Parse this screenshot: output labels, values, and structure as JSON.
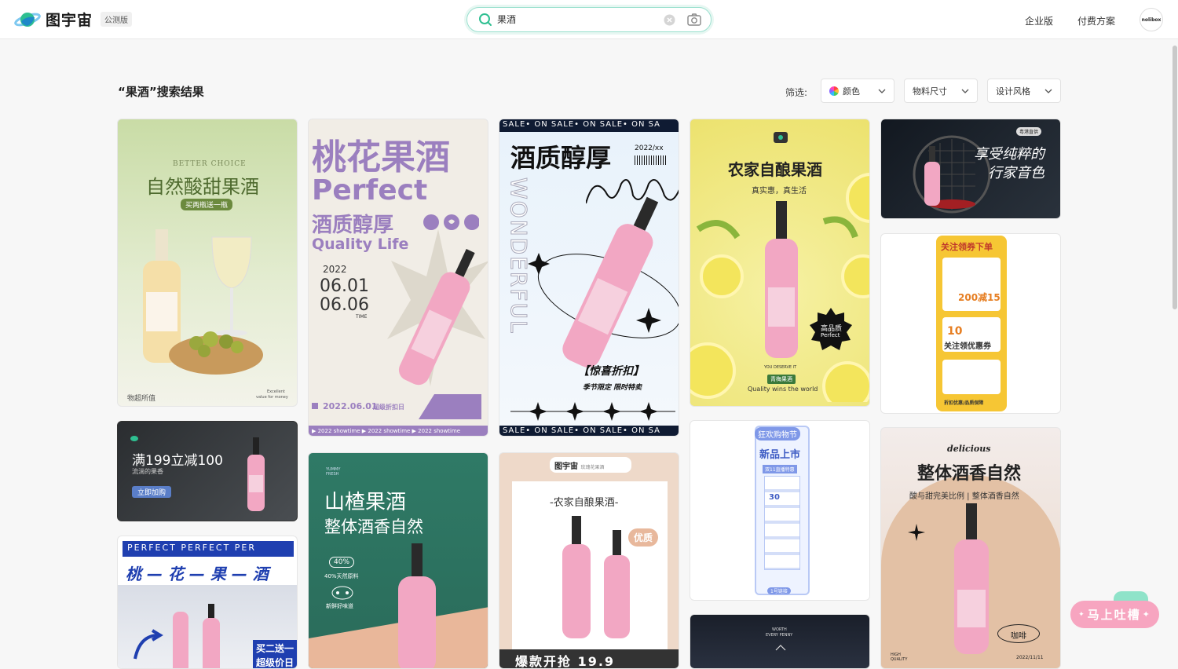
{
  "app": {
    "name": "图宇宙",
    "badge": "公测版"
  },
  "search": {
    "value": "果酒"
  },
  "nav": {
    "enterprise": "企业版",
    "pricing": "付费方案",
    "avatar": "nolibox"
  },
  "results": {
    "title": "“果酒”搜索结果",
    "filter_label": "筛选:"
  },
  "filters": [
    {
      "label": "颜色",
      "icon": "color-wheel-icon"
    },
    {
      "label": "物料尺寸"
    },
    {
      "label": "设计风格"
    }
  ],
  "feedback_button": "马上吐槽",
  "colors": {
    "accent": "#2ebf91",
    "bottle_pink": "#f2a7c3",
    "feedback": "#f7a5c0"
  },
  "cards": {
    "c1": {
      "top": "BETTER CHOICE",
      "title": "自然酸甜果酒",
      "tag": "买两瓶送一瓶",
      "foot_left": "物超所值",
      "foot_right1": "Excellent",
      "foot_right2": "value for money"
    },
    "c2": {
      "title": "桃花果酒",
      "perfect": "Perfect",
      "sub": "酒质醇厚",
      "quality": "Quality Life",
      "year": "2022",
      "d1": "06.01",
      "d2": "06.06",
      "time": "TIME",
      "date_line": "2022.06.01",
      "date_tag": "超级折扣日",
      "showtime": "▶ 2022 showtime  ▶ 2022 showtime  ▶ 2022 showtime"
    },
    "c3": {
      "sale": "SALE• ON  SALE• ON  SALE• ON  SA",
      "title": "酒质醇厚",
      "year": "2022/xx",
      "vertical": "WONDERFUL",
      "promo": "【惊喜折扣】",
      "promo_sub": "季节限定  限时特卖"
    },
    "c4": {
      "title": "农家自酿果酒",
      "sub": "真实惠，真生活",
      "badge1": "高品质",
      "badge2": "Perfect",
      "deserve": "YOU DESERVE IT",
      "tag": "青梅果酒",
      "world": "Quality wins the world"
    },
    "c5": {
      "badge": "粤港直供",
      "title1": "享受纯粹的",
      "title2": "行家音色"
    },
    "c6": {
      "title": "关注领券下单",
      "amount": "200减15",
      "ten": "10",
      "coupon": "关注领优惠券",
      "foot": "折扣优惠/品质保障"
    },
    "c7": {
      "title": "满199立减100",
      "sub": "流淌的果香",
      "btn": "立即加购"
    },
    "c8": {
      "brand": "YUMMY FRESH",
      "title": "山楂果酒",
      "sub": "整体酒香自然",
      "p1": "40%",
      "p1d": "40%天然原料",
      "p2d": "新鲜好味道"
    },
    "c9": {
      "brand": "图宇宙",
      "brand2": "玫瑰花果酒",
      "title": "-农家自酿果酒-",
      "badge": "优质",
      "bottom": "爆款开抢 19.9"
    },
    "c10": {
      "top": "狂欢购物节",
      "title": "新品上市",
      "sub": "双11直播特惠",
      "n30": "30",
      "foot": "1号链接"
    },
    "c11": {
      "eyebrow": "delicious",
      "title": "整体酒香自然",
      "sub": "酸与甜完美比例 | 整体酒香自然",
      "coffee": "咖啡",
      "foot_left": "HIGH QUALITY",
      "foot_date": "2022/11/11"
    },
    "c12": {
      "top1": "WORTH",
      "top2": "EVERY PENNY"
    },
    "c13": {
      "header": "PERFECT PERFECT PER",
      "title": "桃 — 花 — 果 — 酒",
      "tag": "买二送一",
      "tag2": "超级价日"
    }
  }
}
